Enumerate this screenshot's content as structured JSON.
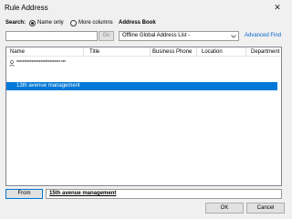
{
  "window": {
    "title": "Rule Address",
    "close_glyph": "✕"
  },
  "search": {
    "label": "Search:",
    "option_name_only": "Name only",
    "option_more_columns": "More columns",
    "selected": "Name only",
    "input_value": "",
    "go_label": "Go"
  },
  "address_book": {
    "label": "Address Book",
    "selected": "Offline Global Address List -",
    "advanced_find": "Advanced Find"
  },
  "columns": [
    "Name",
    "Title",
    "Business Phone",
    "Location",
    "Department"
  ],
  "rows": [
    {
      "name": "*****************************  ***",
      "selected": false,
      "icon": "contact-icon"
    },
    {
      "name": "13th avenue management",
      "selected": true,
      "icon": ""
    }
  ],
  "from": {
    "button_label": "From",
    "value": "15th avenue management"
  },
  "buttons": {
    "ok": "OK",
    "cancel": "Cancel"
  },
  "colors": {
    "selection": "#0078d7",
    "link": "#0066cc"
  }
}
